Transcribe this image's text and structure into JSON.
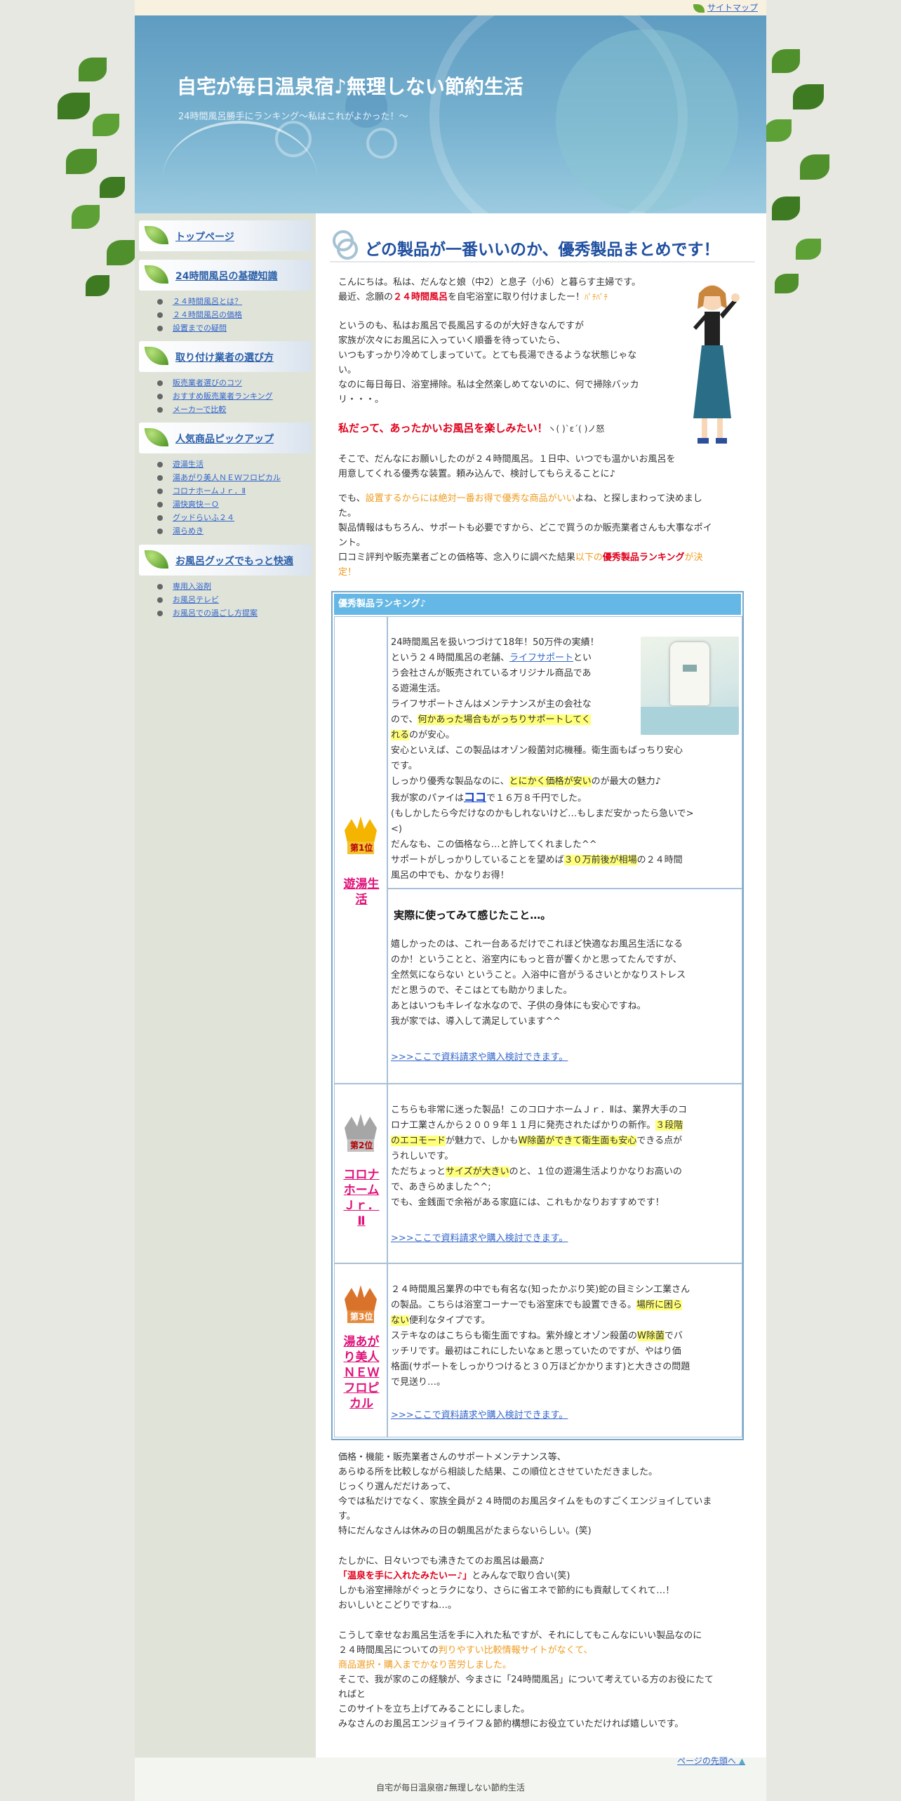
{
  "topbar": {
    "sitemap": "サイトマップ"
  },
  "header": {
    "title": "自宅が毎日温泉宿♪無理しない節約生活",
    "subtitle": "24時間風呂勝手にランキング～私はこれがよかった！～"
  },
  "sidebar": {
    "sections": [
      {
        "title": "トップページ",
        "items": []
      },
      {
        "title": "24時間風呂の基礎知識",
        "items": [
          "２４時間風呂とは？",
          "２４時間風呂の価格",
          "設置までの疑問"
        ]
      },
      {
        "title": "取り付け業者の選び方",
        "items": [
          "販売業者選びのコツ",
          "おすすめ販売業者ランキング",
          "メーカーで比較"
        ]
      },
      {
        "title": "人気商品ピックアップ",
        "items": [
          "遊湯生活",
          "湯あがり美人ＮＥＷフロピカル",
          "コロナホームＪｒ．Ⅱ",
          "湯快爽快－Ｏ",
          "グッドらいふ２４",
          "湯らめき"
        ]
      },
      {
        "title": "お風呂グッズでもっと快適",
        "items": [
          "専用入浴剤",
          "お風呂テレビ",
          "お風呂での過ごし方提案"
        ]
      }
    ]
  },
  "main": {
    "title": "どの製品が一番いいのか、優秀製品まとめです！",
    "intro": {
      "p1_l1": "こんにちは。私は、だんなと娘（中2）と息子（小6）と暮らす主婦です。",
      "p1_l2a": "最近、念願の",
      "p1_l2b": "２４時間風呂",
      "p1_l2c": "を自宅浴室に取り付けましたー！",
      "p1_l2d": "ﾊﾟﾁﾊﾟﾁ",
      "p2_l1": "というのも、私はお風呂で長風呂するのが大好きなんですが",
      "p2_l2": "家族が次々にお風呂に入っていく順番を待っていたら、",
      "p2_l3": "いつもすっかり冷めてしまっていて。とても長湯できるような状態じゃな",
      "p2_l4": "い。",
      "p2_l5": "なのに毎日毎日、浴室掃除。私は全然楽しめてないのに、何で掃除バッカ",
      "p2_l6": "リ・・・。",
      "p3_red": "私だって、あったかいお風呂を楽しみたい！",
      "p3_face": "ヽ( )`ε´( )ノ怒",
      "p4_l1": "そこで、だんなにお願いしたのが２４時間風呂。１日中、いつでも温かいお風呂を",
      "p4_l2": "用意してくれる優秀な装置。頼み込んで、検討してもらえることに♪",
      "p5_l1a": "でも、",
      "p5_l1b": "設置するからには絶対一番お得で優秀な商品がいい",
      "p5_l1c": "よね、と探しまわって決めまし",
      "p5_l2": "た。",
      "p5_l3": "製品情報はもちろん、サポートも必要ですから、どこで買うのか販売業者さんも大事なポイ",
      "p5_l4": "ント。",
      "p5_l5a": "口コミ評判や販売業者ごとの価格等、念入りに調べた結果",
      "p5_l5b": "以下の",
      "p5_l5c": "優秀製品ランキング",
      "p5_l5d": "が決",
      "p5_l6": "定！"
    },
    "ranking": {
      "header": "優秀製品ランキング♪",
      "items": [
        {
          "rank_label": "第1位",
          "name": "遊湯生活",
          "lines": [
            "24時間風呂を扱いつづけて18年！50万件の実績！",
            "という２４時間風呂の老舗、",
            "ライフサポート",
            "とい",
            "う会社さんが販売されているオリジナル商品であ",
            "る遊湯生活。",
            "ライフサポートさんはメンテナンスが主の会社な",
            "ので、",
            "何かあった場合もがっちりサポートしてく",
            "れる",
            "のが安心。",
            "安心といえば、この製品はオゾン殺菌対応機種。衛生面もばっちり安心",
            "です。",
            "しっかり優秀な製品なのに、",
            "とにかく価格が安い",
            "のが最大の魅力♪",
            "我が家のパァイは",
            "ココ",
            "で１６万８千円でした。",
            "(もしかしたら今だけなのかもしれないけど…もしまだ安かったら急いで>",
            "<)",
            "だんなも、この価格なら…と許してくれました^^",
            "サポートがしっかりしていることを望めば",
            "３０万前後が相場",
            "の２４時間",
            "風呂の中でも、かなりお得！"
          ],
          "review_title": "実際に使ってみて感じたこと…。",
          "review": [
            "嬉しかったのは、これ一台あるだけでこれほど快適なお風呂生活になる",
            "のか！ということと、浴室内にもっと音が響くかと思ってたんですが、",
            "全然気にならない ということ。入浴中に音がうるさいとかなりストレス",
            "だと思うので、そこはとても助かりました。",
            "あとはいつもキレイな水なので、子供の身体にも安心ですね。",
            "我が家では、導入して満足しています^^"
          ],
          "link": ">>>ここで資料請求や購入検討できます。"
        },
        {
          "rank_label": "第2位",
          "name": "コロナホームＪｒ．Ⅱ",
          "name_lines": [
            "コロナ",
            "ホーム",
            "Ｊｒ．",
            "Ⅱ"
          ],
          "lines": [
            " こちらも非常に迷った製品！このコロナホームＪｒ．Ⅱは、業界大手のコ",
            "ロナ工業さんから２００９年１１月に発売されたばかりの新作。",
            "３段階",
            "のエコモード",
            "が魅力で、しかも",
            "W除菌ができて衛生面も安心",
            "できる点が",
            "うれしいです。",
            "ただちょっと",
            "サイズが大きい",
            "のと、１位の遊湯生活よりかなりお高いの",
            "で、あきらめました^^;",
            "でも、金銭面で余裕がある家庭には、これもかなりおすすめです！"
          ],
          "link": ">>>ここで資料請求や購入検討できます。"
        },
        {
          "rank_label": "第3位",
          "name": "湯あがり美人ＮＥＷフロピカル",
          "name_lines": [
            "湯あが",
            "り美人",
            "ＮＥＷ",
            "フロピ",
            "カル"
          ],
          "lines": [
            " ２４時間風呂業界の中でも有名な(知ったかぶり笑)蛇の目ミシン工業さん",
            "の製品。こちらは浴室コーナーでも浴室床でも設置できる。",
            "場所に困ら",
            "ない",
            "便利なタイプです。",
            "ステキなのはこちらも衛生面ですね。紫外線とオゾン殺菌の",
            "W除菌",
            "でバ",
            "ッチリです。最初はこれにしたいなぁと思っていたのですが、やはり価",
            "格面(サポートをしっかりつけると３０万ほどかかります)と大きさの問題",
            "で見送り…。"
          ],
          "link": ">>>ここで資料請求や購入検討できます。"
        }
      ]
    },
    "outro": {
      "l1": "価格・機能・販売業者さんのサポートメンテナンス等、",
      "l2": "あらゆる所を比較しながら相談した結果、この順位とさせていただきました。",
      "l3": "じっくり選んだだけあって、",
      "l4": "今では私だけでなく、家族全員が２４時間のお風呂タイムをものすごくエンジョイしていま",
      "l5": "す。",
      "l6": "特にだんなさんは休みの日の朝風呂がたまらないらしい。(笑)",
      "l7": "たしかに、日々いつでも沸きたてのお風呂は最高♪",
      "l8a": "「温泉を手に入れたみたいー♪」",
      "l8b": "とみんなで取り合い(笑)",
      "l9": "しかも浴室掃除がぐっとラクになり、さらに省エネで節約にも貢献してくれて…！",
      "l10": "おいしいとこどりですね…。",
      "l11": "こうして幸せなお風呂生活を手に入れた私ですが、それにしてもこんなにいい製品なのに",
      "l12a": "２４時間風呂についての",
      "l12b": "判りやすい比較情報サイトがなくて、",
      "l13": "商品選択・購入までかなり苦労しました。",
      "l14": "そこで、我が家のこの経験が、今まさに「24時間風呂」について考えている方のお役にたて",
      "l15": "ればと",
      "l16": "このサイトを立ち上げてみることにしました。",
      "l17": "みなさんのお風呂エンジョイライフ＆節約構想にお役立ていただければ嬉しいです。"
    }
  },
  "footer": {
    "back_to_top": "ページの先頭へ",
    "site_name": "自宅が毎日温泉宿♪無理しない節約生活"
  }
}
